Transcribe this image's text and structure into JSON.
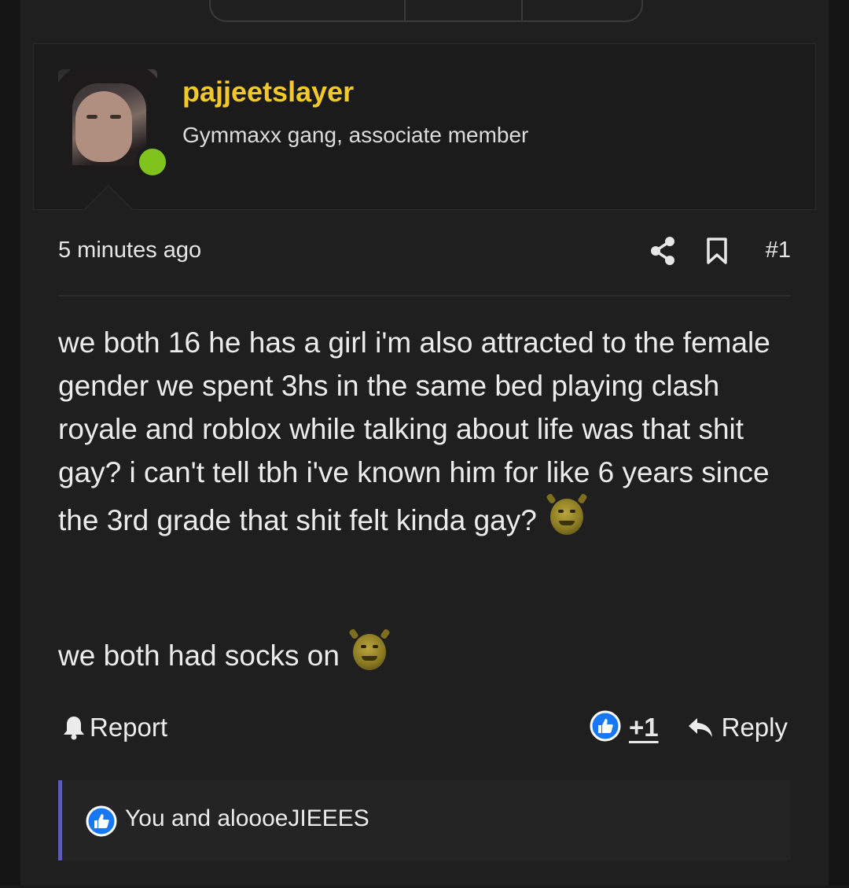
{
  "author": {
    "username": "pajjeetslayer",
    "user_title": "Gymmaxx gang, associate member",
    "online_status_color": "#7fc31c",
    "username_color": "#f2c928"
  },
  "post": {
    "timestamp": "5 minutes ago",
    "post_number": "#1",
    "body_paragraph": "we both 16 he has a girl i'm also attracted to the female gender we spent 3hs in the same bed playing clash royale and roblox while talking about life was that shit gay? i can't tell tbh i've known him for like 6 years since the 3rd grade that shit felt kinda gay?",
    "body_line2": "we both had socks on",
    "emoji": "shrek-emoji"
  },
  "actions": {
    "report_label": "Report",
    "like_count": "+1",
    "reply_label": "Reply"
  },
  "reactions": {
    "summary": "You and aloooeJIEEES"
  },
  "icons": {
    "share": "share-icon",
    "bookmark": "bookmark-icon",
    "report": "bell-icon",
    "like": "thumbs-up-icon",
    "reply": "reply-arrow-icon"
  },
  "colors": {
    "accent_like": "#1877f2",
    "reaction_bar": "#5b5fb3",
    "background": "#1f1f1f"
  }
}
